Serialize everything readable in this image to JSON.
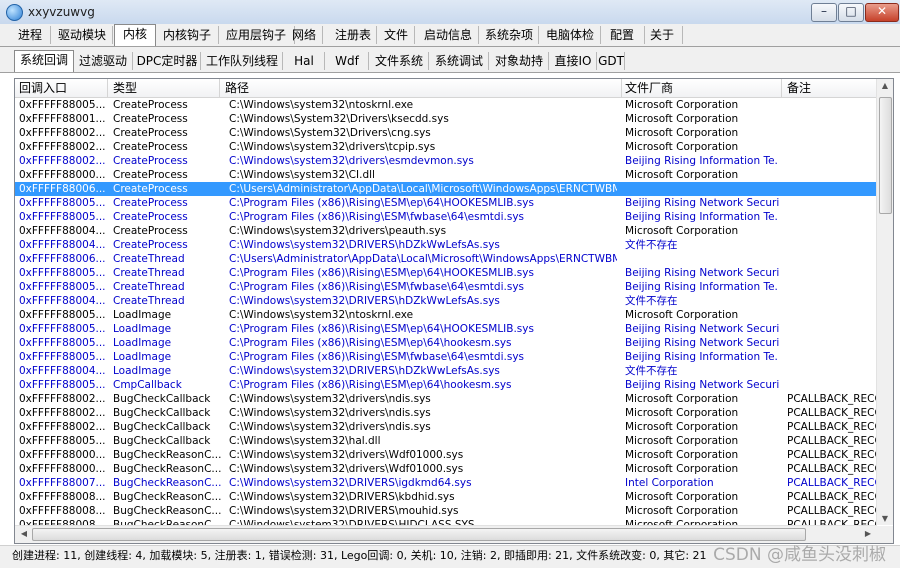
{
  "window": {
    "title": "xxyvzuwvg"
  },
  "main_tabs": [
    "进程",
    "驱动模块",
    "内核",
    "内核钩子",
    "应用层钩子",
    "网络",
    "注册表",
    "文件",
    "启动信息",
    "系统杂项",
    "电脑体检",
    "配置",
    "关于"
  ],
  "sub_tabs": [
    "系统回调",
    "过滤驱动",
    "DPC定时器",
    "工作队列线程",
    "Hal",
    "Wdf",
    "文件系统",
    "系统调试",
    "对象劫持",
    "直接IO",
    "GDT"
  ],
  "columns": [
    "回调入口",
    "类型",
    "路径",
    "文件厂商",
    "备注"
  ],
  "colors": {
    "normal": "#000000",
    "blue": "#0000cc",
    "selected": "#3399ff"
  },
  "rows": [
    {
      "entry": "0xFFFFF88005...",
      "type": "CreateProcess",
      "path": "C:\\Windows\\system32\\ntoskrnl.exe",
      "vendor": "Microsoft Corporation",
      "note": "",
      "blue": false
    },
    {
      "entry": "0xFFFFF88001...",
      "type": "CreateProcess",
      "path": "C:\\Windows\\System32\\Drivers\\ksecdd.sys",
      "vendor": "Microsoft Corporation",
      "note": "",
      "blue": false
    },
    {
      "entry": "0xFFFFF88002...",
      "type": "CreateProcess",
      "path": "C:\\Windows\\System32\\Drivers\\cng.sys",
      "vendor": "Microsoft Corporation",
      "note": "",
      "blue": false
    },
    {
      "entry": "0xFFFFF88002...",
      "type": "CreateProcess",
      "path": "C:\\Windows\\system32\\drivers\\tcpip.sys",
      "vendor": "Microsoft Corporation",
      "note": "",
      "blue": false
    },
    {
      "entry": "0xFFFFF88002...",
      "type": "CreateProcess",
      "path": "C:\\Windows\\system32\\drivers\\esmdevmon.sys",
      "vendor": "Beijing Rising Information Te...",
      "note": "",
      "blue": true
    },
    {
      "entry": "0xFFFFF88000...",
      "type": "CreateProcess",
      "path": "C:\\Windows\\system32\\CI.dll",
      "vendor": "Microsoft Corporation",
      "note": "",
      "blue": false
    },
    {
      "entry": "0xFFFFF88006...",
      "type": "CreateProcess",
      "path": "C:\\Users\\Administrator\\AppData\\Local\\Microsoft\\WindowsApps\\ERNCTWBM.sys",
      "vendor": "",
      "note": "",
      "blue": false,
      "selected": true
    },
    {
      "entry": "0xFFFFF88005...",
      "type": "CreateProcess",
      "path": "C:\\Program Files (x86)\\Rising\\ESM\\ep\\64\\HOOKESMLIB.sys",
      "vendor": "Beijing Rising Network Securi...",
      "note": "",
      "blue": true
    },
    {
      "entry": "0xFFFFF88005...",
      "type": "CreateProcess",
      "path": "C:\\Program Files (x86)\\Rising\\ESM\\fwbase\\64\\esmtdi.sys",
      "vendor": "Beijing Rising Information Te...",
      "note": "",
      "blue": true
    },
    {
      "entry": "0xFFFFF88004...",
      "type": "CreateProcess",
      "path": "C:\\Windows\\system32\\drivers\\peauth.sys",
      "vendor": "Microsoft Corporation",
      "note": "",
      "blue": false
    },
    {
      "entry": "0xFFFFF88004...",
      "type": "CreateProcess",
      "path": "C:\\Windows\\system32\\DRIVERS\\hDZkWwLefsAs.sys",
      "vendor": "文件不存在",
      "note": "",
      "blue": true
    },
    {
      "entry": "0xFFFFF88006...",
      "type": "CreateThread",
      "path": "C:\\Users\\Administrator\\AppData\\Local\\Microsoft\\WindowsApps\\ERNCTWBM.sys",
      "vendor": "",
      "note": "",
      "blue": true
    },
    {
      "entry": "0xFFFFF88005...",
      "type": "CreateThread",
      "path": "C:\\Program Files (x86)\\Rising\\ESM\\ep\\64\\HOOKESMLIB.sys",
      "vendor": "Beijing Rising Network Securi...",
      "note": "",
      "blue": true
    },
    {
      "entry": "0xFFFFF88005...",
      "type": "CreateThread",
      "path": "C:\\Program Files (x86)\\Rising\\ESM\\fwbase\\64\\esmtdi.sys",
      "vendor": "Beijing Rising Information Te...",
      "note": "",
      "blue": true
    },
    {
      "entry": "0xFFFFF88004...",
      "type": "CreateThread",
      "path": "C:\\Windows\\system32\\DRIVERS\\hDZkWwLefsAs.sys",
      "vendor": "文件不存在",
      "note": "",
      "blue": true
    },
    {
      "entry": "0xFFFFF88005...",
      "type": "LoadImage",
      "path": "C:\\Windows\\system32\\ntoskrnl.exe",
      "vendor": "Microsoft Corporation",
      "note": "",
      "blue": false
    },
    {
      "entry": "0xFFFFF88005...",
      "type": "LoadImage",
      "path": "C:\\Program Files (x86)\\Rising\\ESM\\ep\\64\\HOOKESMLIB.sys",
      "vendor": "Beijing Rising Network Securi...",
      "note": "",
      "blue": true
    },
    {
      "entry": "0xFFFFF88005...",
      "type": "LoadImage",
      "path": "C:\\Program Files (x86)\\Rising\\ESM\\ep\\64\\hookesm.sys",
      "vendor": "Beijing Rising Network Securi...",
      "note": "",
      "blue": true
    },
    {
      "entry": "0xFFFFF88005...",
      "type": "LoadImage",
      "path": "C:\\Program Files (x86)\\Rising\\ESM\\fwbase\\64\\esmtdi.sys",
      "vendor": "Beijing Rising Information Te...",
      "note": "",
      "blue": true
    },
    {
      "entry": "0xFFFFF88004...",
      "type": "LoadImage",
      "path": "C:\\Windows\\system32\\DRIVERS\\hDZkWwLefsAs.sys",
      "vendor": "文件不存在",
      "note": "",
      "blue": true
    },
    {
      "entry": "0xFFFFF88005...",
      "type": "CmpCallback",
      "path": "C:\\Program Files (x86)\\Rising\\ESM\\ep\\64\\hookesm.sys",
      "vendor": "Beijing Rising Network Securi...",
      "note": "",
      "blue": true
    },
    {
      "entry": "0xFFFFF88002...",
      "type": "BugCheckCallback",
      "path": "C:\\Windows\\system32\\drivers\\ndis.sys",
      "vendor": "Microsoft Corporation",
      "note": "PCALLBACK_RECO",
      "blue": false
    },
    {
      "entry": "0xFFFFF88002...",
      "type": "BugCheckCallback",
      "path": "C:\\Windows\\system32\\drivers\\ndis.sys",
      "vendor": "Microsoft Corporation",
      "note": "PCALLBACK_RECO",
      "blue": false
    },
    {
      "entry": "0xFFFFF88002...",
      "type": "BugCheckCallback",
      "path": "C:\\Windows\\system32\\drivers\\ndis.sys",
      "vendor": "Microsoft Corporation",
      "note": "PCALLBACK_RECO",
      "blue": false
    },
    {
      "entry": "0xFFFFF88005...",
      "type": "BugCheckCallback",
      "path": "C:\\Windows\\system32\\hal.dll",
      "vendor": "Microsoft Corporation",
      "note": "PCALLBACK_RECO",
      "blue": false
    },
    {
      "entry": "0xFFFFF88000...",
      "type": "BugCheckReasonC...",
      "path": "C:\\Windows\\system32\\drivers\\Wdf01000.sys",
      "vendor": "Microsoft Corporation",
      "note": "PCALLBACK_RECO",
      "blue": false
    },
    {
      "entry": "0xFFFFF88000...",
      "type": "BugCheckReasonC...",
      "path": "C:\\Windows\\system32\\drivers\\Wdf01000.sys",
      "vendor": "Microsoft Corporation",
      "note": "PCALLBACK_RECO",
      "blue": false
    },
    {
      "entry": "0xFFFFF88007...",
      "type": "BugCheckReasonC...",
      "path": "C:\\Windows\\system32\\DRIVERS\\igdkmd64.sys",
      "vendor": "Intel Corporation",
      "note": "PCALLBACK_RECO",
      "blue": true
    },
    {
      "entry": "0xFFFFF88008...",
      "type": "BugCheckReasonC...",
      "path": "C:\\Windows\\system32\\DRIVERS\\kbdhid.sys",
      "vendor": "Microsoft Corporation",
      "note": "PCALLBACK_RECO",
      "blue": false
    },
    {
      "entry": "0xFFFFF88008...",
      "type": "BugCheckReasonC...",
      "path": "C:\\Windows\\system32\\DRIVERS\\mouhid.sys",
      "vendor": "Microsoft Corporation",
      "note": "PCALLBACK_RECO",
      "blue": false
    },
    {
      "entry": "0xFFFFF88008...",
      "type": "BugCheckReasonC...",
      "path": "C:\\Windows\\system32\\DRIVERS\\HIDCLASS.SYS",
      "vendor": "Microsoft Corporation",
      "note": "PCALLBACK_RECO",
      "blue": false
    }
  ],
  "status_text": "创建进程: 11, 创建线程: 4, 加载模块: 5, 注册表: 1, 错误检测: 31, Lego回调: 0, 关机: 10, 注销: 2, 即插即用: 21, 文件系统改变: 0, 其它: 21",
  "watermark": "CSDN @咸鱼头没刺椒"
}
